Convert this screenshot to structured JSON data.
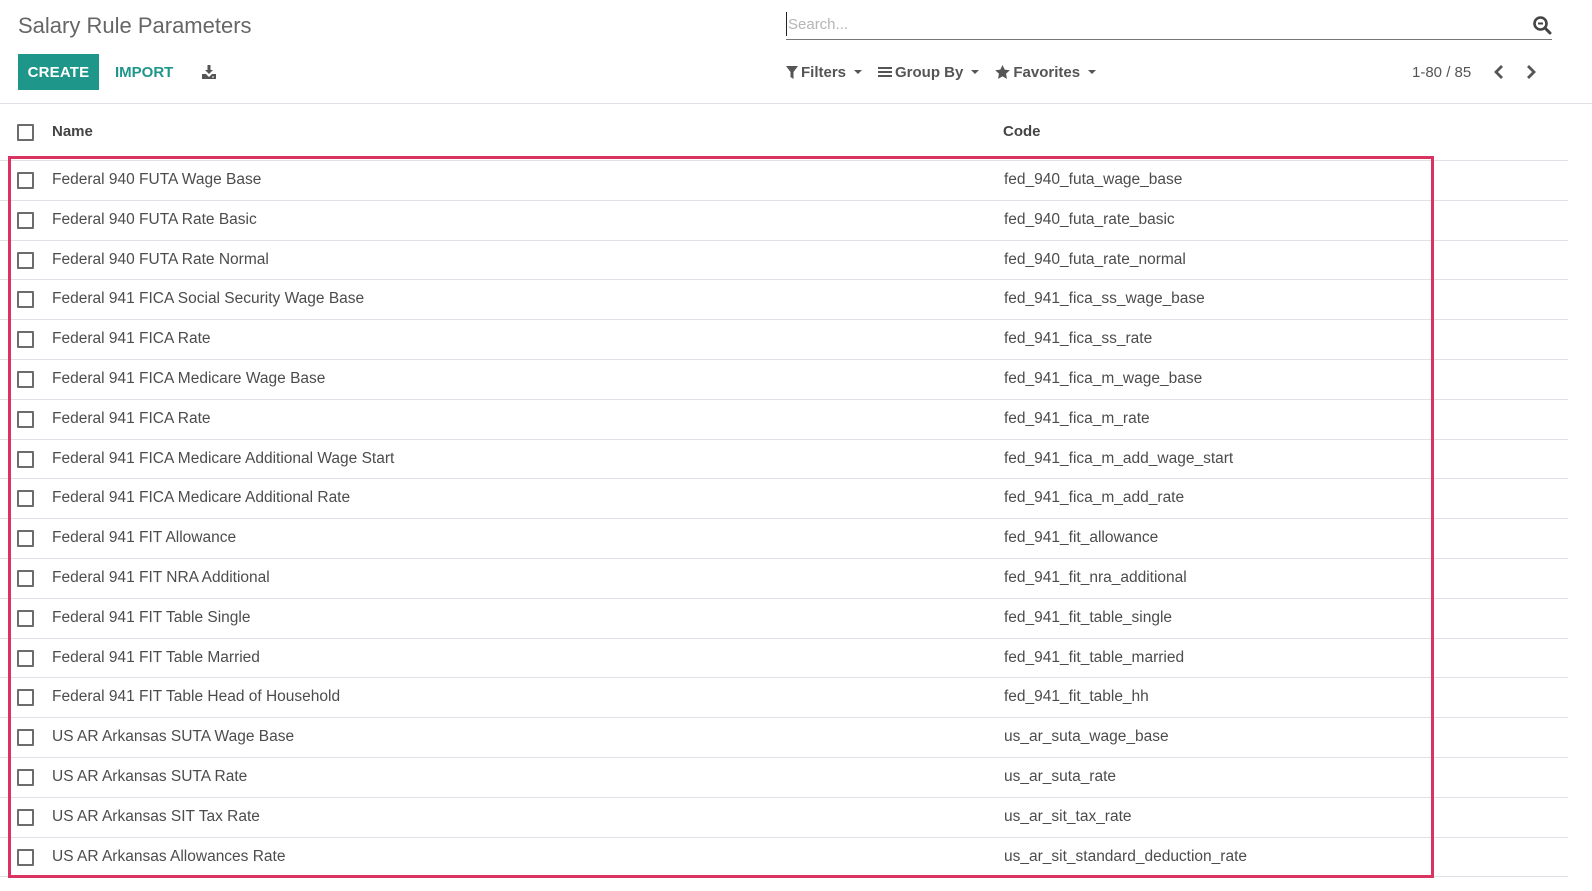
{
  "page": {
    "title": "Salary Rule Parameters"
  },
  "toolbar": {
    "create_label": "CREATE",
    "import_label": "IMPORT",
    "download_icon": "download-icon"
  },
  "search": {
    "placeholder": "Search...",
    "value": "",
    "icon": "search-icon"
  },
  "search_options": {
    "filters_label": "Filters",
    "group_by_label": "Group By",
    "favorites_label": "Favorites"
  },
  "pager": {
    "value": "1-80 / 85",
    "prev_icon": "chevron-left-icon",
    "next_icon": "chevron-right-icon"
  },
  "table": {
    "columns": [
      "Name",
      "Code"
    ],
    "rows": [
      {
        "name": "Federal 940 FUTA Wage Base",
        "code": "fed_940_futa_wage_base"
      },
      {
        "name": "Federal 940 FUTA Rate Basic",
        "code": "fed_940_futa_rate_basic"
      },
      {
        "name": "Federal 940 FUTA Rate Normal",
        "code": "fed_940_futa_rate_normal"
      },
      {
        "name": "Federal 941 FICA Social Security Wage Base",
        "code": "fed_941_fica_ss_wage_base"
      },
      {
        "name": "Federal 941 FICA Rate",
        "code": "fed_941_fica_ss_rate"
      },
      {
        "name": "Federal 941 FICA Medicare Wage Base",
        "code": "fed_941_fica_m_wage_base"
      },
      {
        "name": "Federal 941 FICA Rate",
        "code": "fed_941_fica_m_rate"
      },
      {
        "name": "Federal 941 FICA Medicare Additional Wage Start",
        "code": "fed_941_fica_m_add_wage_start"
      },
      {
        "name": "Federal 941 FICA Medicare Additional Rate",
        "code": "fed_941_fica_m_add_rate"
      },
      {
        "name": "Federal 941 FIT Allowance",
        "code": "fed_941_fit_allowance"
      },
      {
        "name": "Federal 941 FIT NRA Additional",
        "code": "fed_941_fit_nra_additional"
      },
      {
        "name": "Federal 941 FIT Table Single",
        "code": "fed_941_fit_table_single"
      },
      {
        "name": "Federal 941 FIT Table Married",
        "code": "fed_941_fit_table_married"
      },
      {
        "name": "Federal 941 FIT Table Head of Household",
        "code": "fed_941_fit_table_hh"
      },
      {
        "name": "US AR Arkansas SUTA Wage Base",
        "code": "us_ar_suta_wage_base"
      },
      {
        "name": "US AR Arkansas SUTA Rate",
        "code": "us_ar_suta_rate"
      },
      {
        "name": "US AR Arkansas SIT Tax Rate",
        "code": "us_ar_sit_tax_rate"
      },
      {
        "name": "US AR Arkansas Allowances Rate",
        "code": "us_ar_sit_standard_deduction_rate"
      }
    ]
  },
  "colors": {
    "primary": "#1f968a",
    "highlight_border": "#d93361",
    "text": "#4c4c4c",
    "divider": "#dee2e6"
  }
}
